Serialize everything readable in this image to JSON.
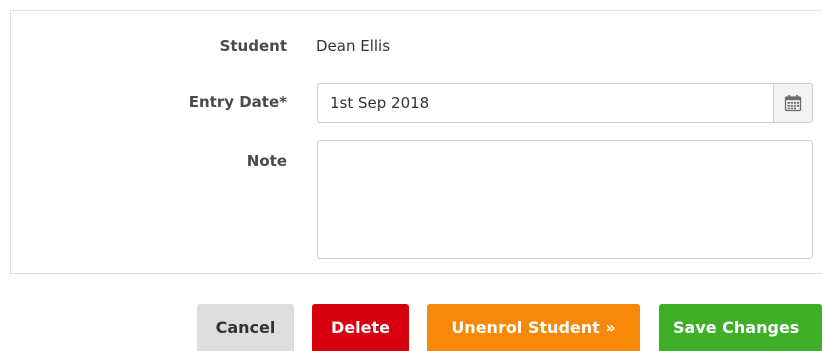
{
  "form": {
    "student_label": "Student",
    "student_value": "Dean Ellis",
    "entry_date_label": "Entry Date*",
    "entry_date_value": "1st Sep 2018",
    "note_label": "Note",
    "note_value": ""
  },
  "icons": {
    "calendar": "calendar-icon"
  },
  "actions": {
    "cancel_label": "Cancel",
    "delete_label": "Delete",
    "unenrol_label": "Unenrol Student »",
    "save_label": "Save Changes"
  },
  "colors": {
    "cancel_bg": "#dddddd",
    "delete_bg": "#d9000f",
    "unenrol_bg": "#f7890a",
    "save_bg": "#3fae29"
  }
}
